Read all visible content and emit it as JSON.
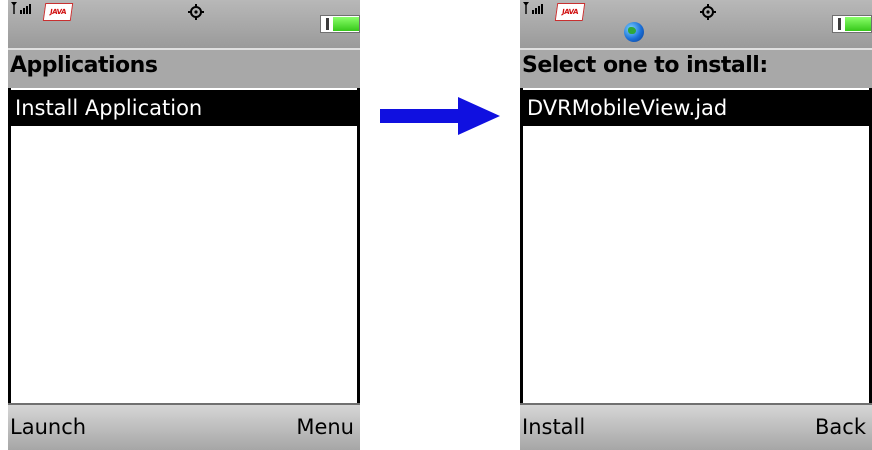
{
  "colors": {
    "arrow": "#1010e0",
    "status_bar": "#a8a8a8",
    "selection_bg": "#000000",
    "selection_fg": "#ffffff"
  },
  "screens": [
    {
      "status_icons": [
        "signal-icon",
        "java-icon",
        "settings-gear-icon",
        "battery-icon"
      ],
      "java_logo_text": "JAVA",
      "title": "Applications",
      "items": [
        {
          "label": "Install Application",
          "selected": true
        }
      ],
      "softkeys": {
        "left": "Launch",
        "right": "Menu"
      }
    },
    {
      "status_icons": [
        "signal-icon",
        "java-icon",
        "globe-icon",
        "settings-gear-icon",
        "battery-icon"
      ],
      "java_logo_text": "JAVA",
      "title": "Select one to install:",
      "items": [
        {
          "label": "DVRMobileView.jad",
          "selected": true
        }
      ],
      "softkeys": {
        "left": "Install",
        "right": "Back"
      }
    }
  ],
  "transition_arrow": "right-arrow-icon"
}
